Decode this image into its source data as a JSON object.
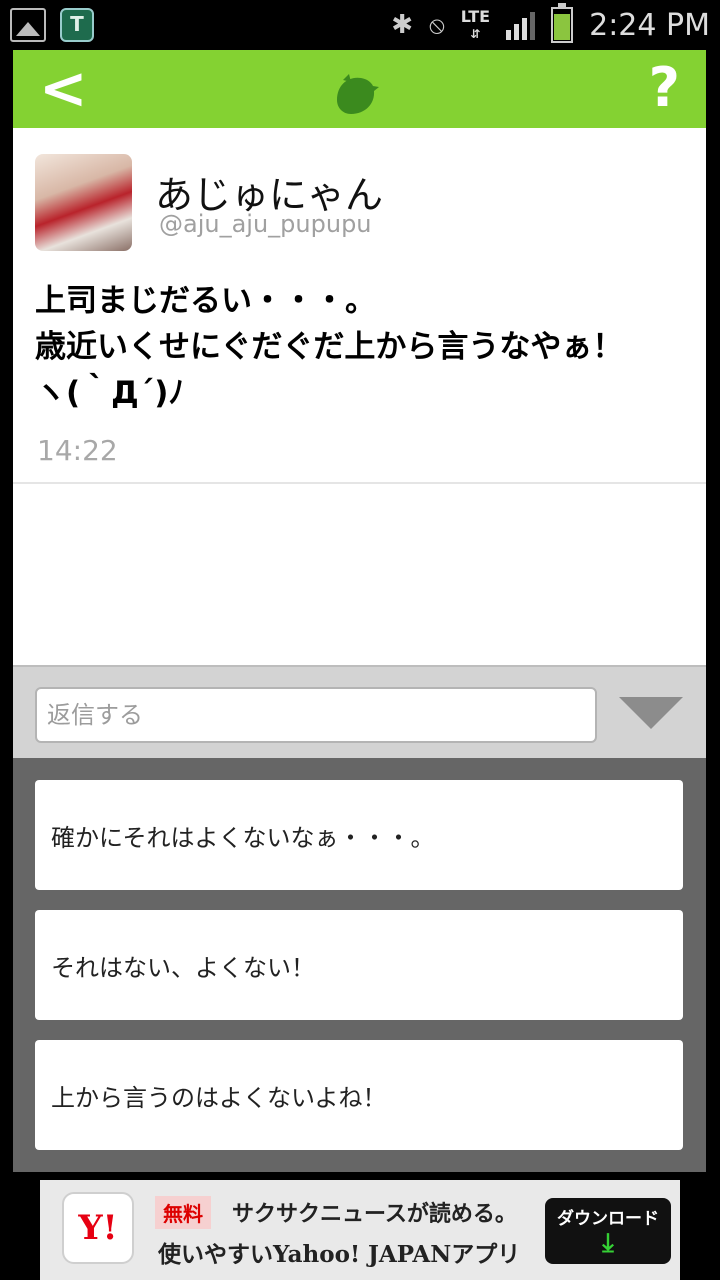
{
  "status_bar": {
    "time": "2:24 PM",
    "network": "LTE",
    "icons": [
      "gallery-icon",
      "app-shield-icon",
      "bluetooth-icon",
      "vibrate-mute-icon",
      "lte-icon",
      "signal-icon",
      "battery-icon"
    ],
    "battery_level": 0.8,
    "signal_bars": 3
  },
  "app_bar": {
    "background": "#84d232",
    "back_icon": "chevron-left-icon",
    "center_icon": "bird-icon",
    "help_icon": "question-mark-icon"
  },
  "tweet": {
    "display_name": "あじゅにゃん",
    "handle": "@aju_aju_pupupu",
    "text_lines": [
      "上司まじだるい・・・。",
      "歳近いくせにぐだぐだ上から言うなやぁ！",
      "ヽ(｀Д´)ﾉ"
    ],
    "time": "14:22"
  },
  "reply": {
    "placeholder": "返信する"
  },
  "suggestions": [
    {
      "label": "確かにそれはよくないなぁ・・・。"
    },
    {
      "label": "それはない、よくない！"
    },
    {
      "label": "上から言うのはよくないよね！"
    }
  ],
  "ad": {
    "logo_text": "Y!",
    "badge": "無料",
    "line1": "サクサクニュースが読める。",
    "line2": "使いやすいYahoo! JAPANアプリ",
    "button_label": "ダウンロード",
    "button_icon": "download-arrow-icon"
  }
}
